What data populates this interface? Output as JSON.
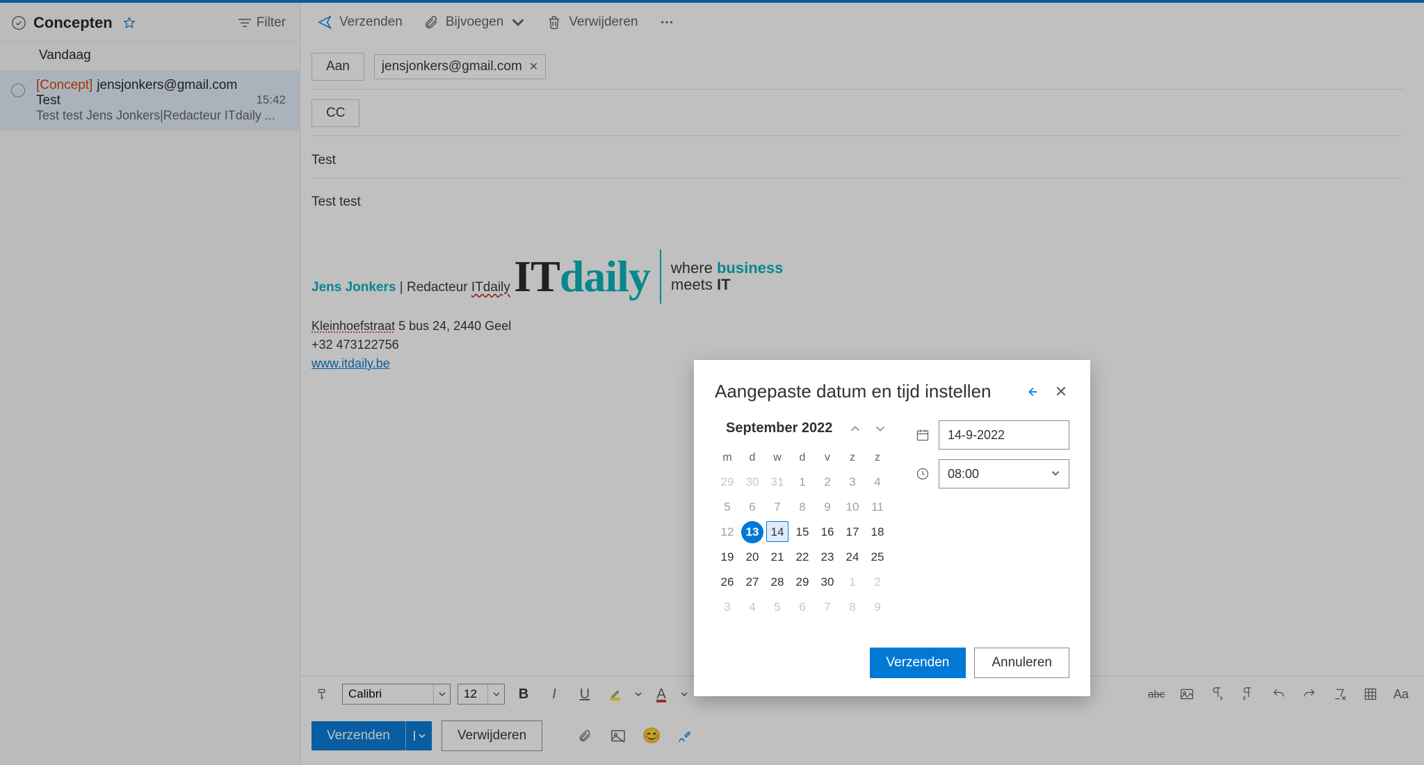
{
  "toolbar": {
    "send": "Verzenden",
    "attach": "Bijvoegen",
    "delete": "Verwijderen"
  },
  "sidebar": {
    "folder": "Concepten",
    "filter": "Filter",
    "section": "Vandaag",
    "item": {
      "tag": "[Concept]",
      "address": "jensjonkers@gmail.com",
      "subject": "Test",
      "time": "15:42",
      "preview": "Test test Jens Jonkers|Redacteur ITdaily ..."
    }
  },
  "compose": {
    "to_btn": "Aan",
    "cc_btn": "CC",
    "recipient": "jensjonkers@gmail.com",
    "subject": "Test",
    "body_first": "Test test",
    "sig_name": "Jens Jonkers",
    "sig_role": "Redacteur",
    "sig_brand": "ITdaily",
    "logo_it": "IT",
    "logo_daily": "daily",
    "tagline1a": "where ",
    "tagline1b": "business",
    "tagline2a": "meets ",
    "tagline2b": "IT",
    "addr_street": "Kleinhoefstraat",
    "addr_rest": " 5 bus 24, 2440 Geel",
    "phone": "+32 473122756",
    "site": "www.itdaily.be"
  },
  "format": {
    "font": "Calibri",
    "size": "12",
    "bold": "B",
    "italic": "I",
    "underline": "U",
    "fontcolor": "A",
    "strike": "abc",
    "casebtn": "Aa"
  },
  "actions": {
    "send": "Verzenden",
    "delete": "Verwijderen"
  },
  "modal": {
    "title": "Aangepaste datum en tijd instellen",
    "month": "September 2022",
    "weekdays": [
      "m",
      "d",
      "w",
      "d",
      "v",
      "z",
      "z"
    ],
    "rows": [
      {
        "cells": [
          {
            "n": "29",
            "cls": "other"
          },
          {
            "n": "30",
            "cls": "other"
          },
          {
            "n": "31",
            "cls": "other"
          },
          {
            "n": "1",
            "cls": "past"
          },
          {
            "n": "2",
            "cls": "past"
          },
          {
            "n": "3",
            "cls": "past"
          },
          {
            "n": "4",
            "cls": "past"
          }
        ]
      },
      {
        "cells": [
          {
            "n": "5",
            "cls": "past"
          },
          {
            "n": "6",
            "cls": "past"
          },
          {
            "n": "7",
            "cls": "past"
          },
          {
            "n": "8",
            "cls": "past"
          },
          {
            "n": "9",
            "cls": "past"
          },
          {
            "n": "10",
            "cls": "past"
          },
          {
            "n": "11",
            "cls": "past"
          }
        ]
      },
      {
        "cells": [
          {
            "n": "12",
            "cls": "past"
          },
          {
            "n": "13",
            "cls": "today"
          },
          {
            "n": "14",
            "cls": "sel"
          },
          {
            "n": "15",
            "cls": ""
          },
          {
            "n": "16",
            "cls": ""
          },
          {
            "n": "17",
            "cls": ""
          },
          {
            "n": "18",
            "cls": ""
          }
        ]
      },
      {
        "cells": [
          {
            "n": "19",
            "cls": ""
          },
          {
            "n": "20",
            "cls": ""
          },
          {
            "n": "21",
            "cls": ""
          },
          {
            "n": "22",
            "cls": ""
          },
          {
            "n": "23",
            "cls": ""
          },
          {
            "n": "24",
            "cls": ""
          },
          {
            "n": "25",
            "cls": ""
          }
        ]
      },
      {
        "cells": [
          {
            "n": "26",
            "cls": ""
          },
          {
            "n": "27",
            "cls": ""
          },
          {
            "n": "28",
            "cls": ""
          },
          {
            "n": "29",
            "cls": ""
          },
          {
            "n": "30",
            "cls": ""
          },
          {
            "n": "1",
            "cls": "other"
          },
          {
            "n": "2",
            "cls": "other"
          }
        ]
      },
      {
        "cells": [
          {
            "n": "3",
            "cls": "other"
          },
          {
            "n": "4",
            "cls": "other"
          },
          {
            "n": "5",
            "cls": "other"
          },
          {
            "n": "6",
            "cls": "other"
          },
          {
            "n": "7",
            "cls": "other"
          },
          {
            "n": "8",
            "cls": "other"
          },
          {
            "n": "9",
            "cls": "other"
          }
        ]
      }
    ],
    "date": "14-9-2022",
    "time": "08:00",
    "send": "Verzenden",
    "cancel": "Annuleren"
  }
}
